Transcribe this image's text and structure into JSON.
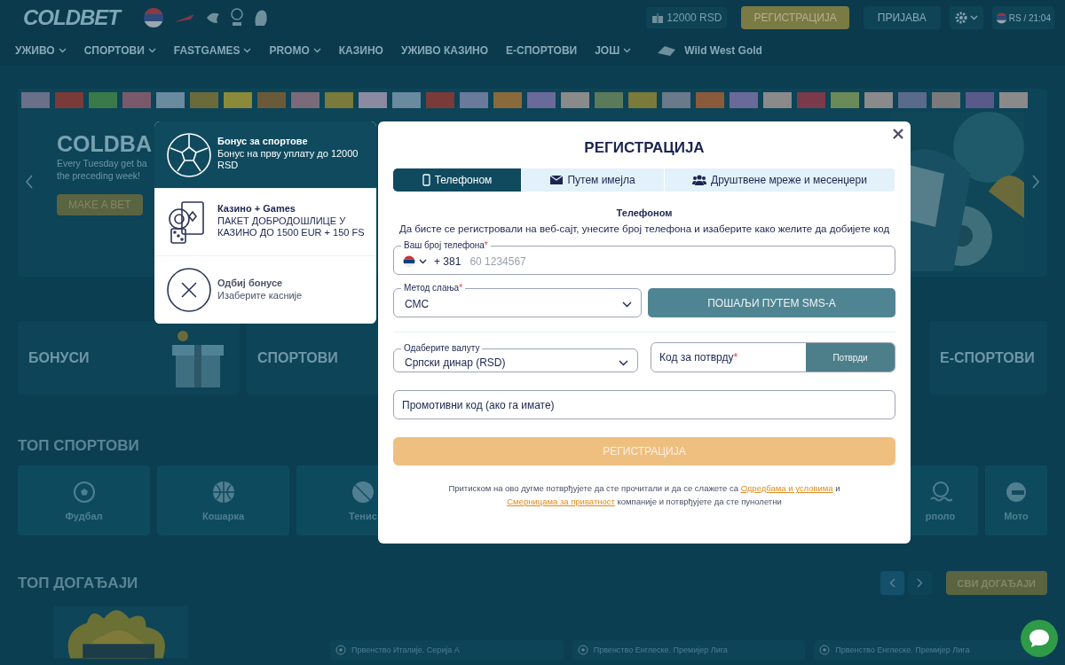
{
  "header": {
    "logo": "COLDBET",
    "balance": "12000 RSD",
    "register": "РЕГИСТРАЦИЈА",
    "login": "ПРИЈАВА",
    "locale": "RS / 21:04"
  },
  "nav": [
    {
      "label": "УЖИВО",
      "kind": "menu",
      "dropdown": true
    },
    {
      "label": "СПОРТОВИ",
      "kind": "menu",
      "dropdown": true
    },
    {
      "label": "FASTGAMES",
      "kind": "menu",
      "dropdown": true
    },
    {
      "label": "PROMO",
      "kind": "menu",
      "dropdown": true
    },
    {
      "label": "КАЗИНО",
      "kind": "menu",
      "dropdown": false
    },
    {
      "label": "УЖИВО КАЗИНО",
      "kind": "menu",
      "dropdown": false
    },
    {
      "label": "Е-СПОРТОВИ",
      "kind": "menu",
      "dropdown": false
    },
    {
      "label": "ЈОШ",
      "kind": "menu",
      "dropdown": true
    },
    {
      "label": "Wild West Gold",
      "kind": "game",
      "dropdown": false
    }
  ],
  "banner": {
    "title": "COLDBA",
    "lines": [
      "Every Tuesday get ba",
      "the preceding week!"
    ],
    "button": "MAKE A BET"
  },
  "categories": [
    {
      "label": "БОНУСИ",
      "kind": "gift"
    },
    {
      "label": "СПОРТОВИ",
      "kind": "plain"
    },
    {
      "label": "Е-СПОРТОВИ",
      "kind": "plain"
    }
  ],
  "top_sports": {
    "title": "ТОП СПОРТОВИ",
    "items": [
      {
        "label": "Фудбал",
        "kind": "football"
      },
      {
        "label": "Кошарка",
        "kind": "basketball"
      },
      {
        "label": "Тенис",
        "kind": "tennis"
      },
      {
        "label": "рполо",
        "kind": "waterpolo"
      },
      {
        "label": "Мото",
        "kind": "moto"
      }
    ]
  },
  "top_events": {
    "title": "ТОП ДОГАЂАЈИ",
    "all_button": "СВИ ДОГАЂАЈИ",
    "events": [
      {
        "league": "Првенство Италије. Серија А"
      },
      {
        "league": "Првенство Енглеске. Премијер Лига"
      },
      {
        "league": "Првенство Енглеске. Премијер Лига"
      }
    ]
  },
  "bonus_menu": [
    {
      "title": "Бонус за спортове",
      "text": "Бонус на прву уплату до 12000 RSD",
      "kind": "sport",
      "selected": true
    },
    {
      "title": "Казино + Games",
      "text": "ПАКЕТ ДОБРОДОШЛИЦЕ У КАЗИНО ДО 1500 EUR + 150 FS",
      "kind": "casino",
      "selected": false
    },
    {
      "title": "Одбиј бонусе",
      "text": "Изаберите касније",
      "kind": "decline",
      "selected": false
    }
  ],
  "modal": {
    "title": "РЕГИСТРАЦИЈА",
    "tabs": [
      {
        "label": "Телефоном",
        "kind": "phone",
        "selected": true
      },
      {
        "label": "Путем имејла",
        "kind": "email",
        "selected": false
      },
      {
        "label": "Друштвене мреже и месенџери",
        "kind": "social",
        "selected": false
      }
    ],
    "heading": "Телефоном",
    "description": "Да бисте се регистровали на веб-сајт, унесите број телефона и изаберите како желите да добијете код",
    "required_mark": "*",
    "phone": {
      "label": "Ваш број телефона",
      "required": true,
      "prefix": "+ 381",
      "placeholder": "60 1234567"
    },
    "method": {
      "label": "Метод слања",
      "required": true,
      "value": "СМС"
    },
    "send_button": "ПОШАЉИ ПУТЕМ SMS-A",
    "currency": {
      "label": "Одаберите валуту",
      "value": "Српски динар (RSD)"
    },
    "code": {
      "label": "Код за потврду",
      "required": true,
      "button": "Потврди"
    },
    "promo": {
      "placeholder": "Промотивни код (ако га имате)"
    },
    "register_button": {
      "label": "РЕГИСТРАЦИЈА",
      "disabled": true
    },
    "legal": [
      {
        "kind": "text",
        "text": "Притиском на ово дугме потврђујете да сте прочитали и да се слажете са"
      },
      {
        "kind": "link",
        "text": "Одредбама и условима"
      },
      {
        "kind": "text",
        "text": "и"
      },
      {
        "kind": "link",
        "text": "Смерницама за приватност"
      },
      {
        "kind": "text",
        "text": "компаније и потврђујете да сте пунолетни"
      }
    ]
  }
}
